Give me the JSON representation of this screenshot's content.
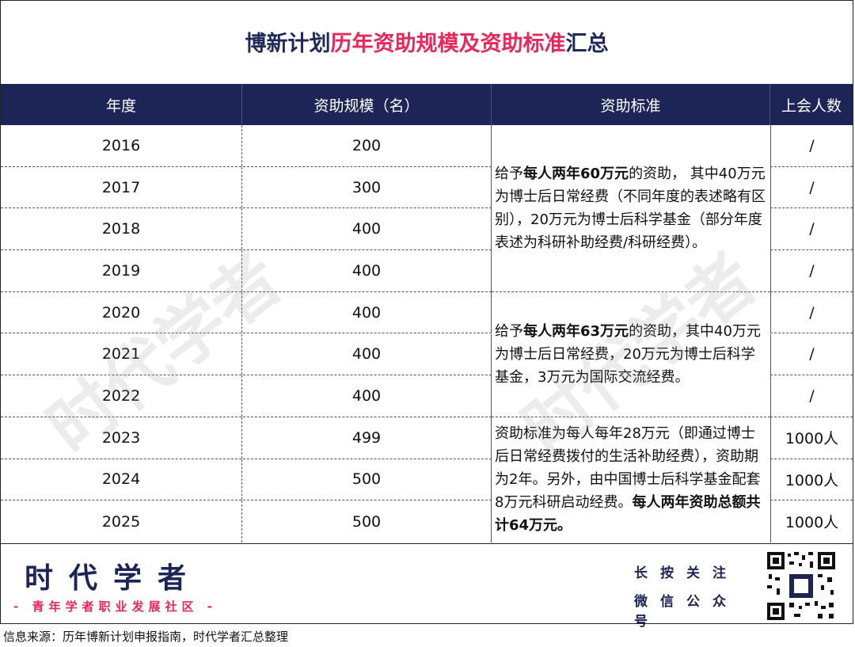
{
  "title": {
    "part1": "博新计划",
    "part2": "历年资助规模及资助标准",
    "part3": "汇总"
  },
  "headers": [
    "年度",
    "资助规模（名）",
    "资助标准",
    "上会人数"
  ],
  "rows": [
    {
      "year": "2016",
      "scale": "200",
      "count": "/"
    },
    {
      "year": "2017",
      "scale": "300",
      "count": "/"
    },
    {
      "year": "2018",
      "scale": "400",
      "count": "/"
    },
    {
      "year": "2019",
      "scale": "400",
      "count": "/"
    },
    {
      "year": "2020",
      "scale": "400",
      "count": "/"
    },
    {
      "year": "2021",
      "scale": "400",
      "count": "/"
    },
    {
      "year": "2022",
      "scale": "400",
      "count": "/"
    },
    {
      "year": "2023",
      "scale": "499",
      "count": "1000人"
    },
    {
      "year": "2024",
      "scale": "500",
      "count": "1000人"
    },
    {
      "year": "2025",
      "scale": "500",
      "count": "1000人"
    }
  ],
  "standards": [
    {
      "pre": "给予",
      "bold": "每人两年60万元",
      "post": "的资助， 其中40万元为博士后日常经费（不同年度的表述略有区别），20万元为博士后科学基金（部分年度表述为科研补助经费/科研经费）。"
    },
    {
      "pre": "给予",
      "bold": "每人两年63万元",
      "post": "的资助，其中40万元为博士后日常经费，20万元为博士后科学基金，3万元为国际交流经费。"
    },
    {
      "pre": "资助标准为每人每年28万元（即通过博士后日常经费拨付的生活补助经费），资助期为2年。另外，由中国博士后科学基金配套8万元科研启动经费。",
      "bold": "每人两年资助总额共计64万元。",
      "post": ""
    }
  ],
  "watermark": "时代学者",
  "footer": {
    "brand": "时代学者",
    "tagline": "- 青年学者职业发展社区 -",
    "follow_line1": "长按关注",
    "follow_line2": "微信公众号"
  },
  "source": "信息来源：历年博新计划申报指南，时代学者汇总整理"
}
